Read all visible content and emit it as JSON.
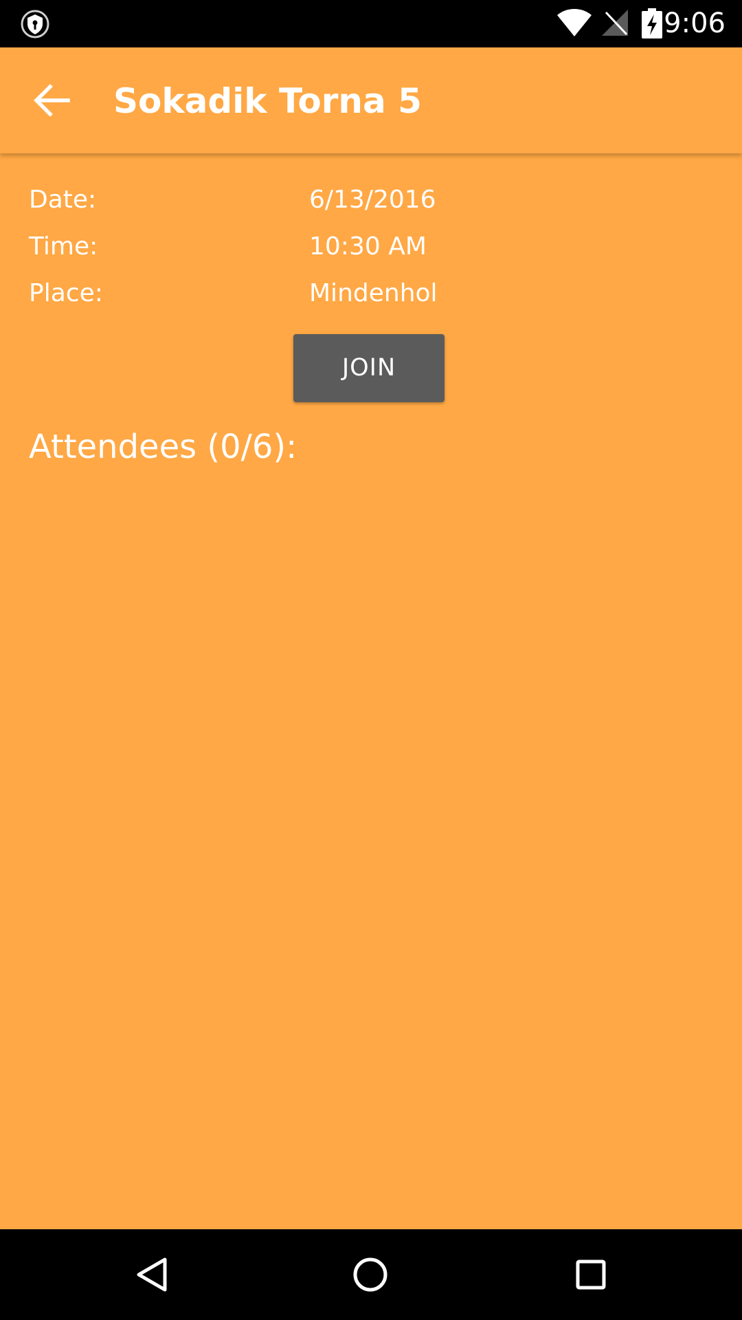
{
  "status_bar": {
    "time": "9:06",
    "icons": [
      "vpn-key-icon",
      "wifi-icon",
      "no-signal-icon",
      "battery-charging-icon"
    ]
  },
  "app_bar": {
    "title": "Sokadik Torna 5",
    "back_icon": "arrow-back-icon"
  },
  "details": {
    "date_label": "Date:",
    "date_value": "6/13/2016",
    "time_label": "Time:",
    "time_value": "10:30 AM",
    "place_label": "Place:",
    "place_value": "Mindenhol"
  },
  "join_button": {
    "label": "JOIN"
  },
  "attendees": {
    "heading": "Attendees (0/6):"
  },
  "nav_bar": {
    "icons": [
      "nav-back-icon",
      "nav-home-icon",
      "nav-recents-icon"
    ]
  },
  "colors": {
    "background": "#FFA845",
    "button": "#5B5B5C",
    "text": "#FFFFFF",
    "system_bars": "#000000"
  }
}
